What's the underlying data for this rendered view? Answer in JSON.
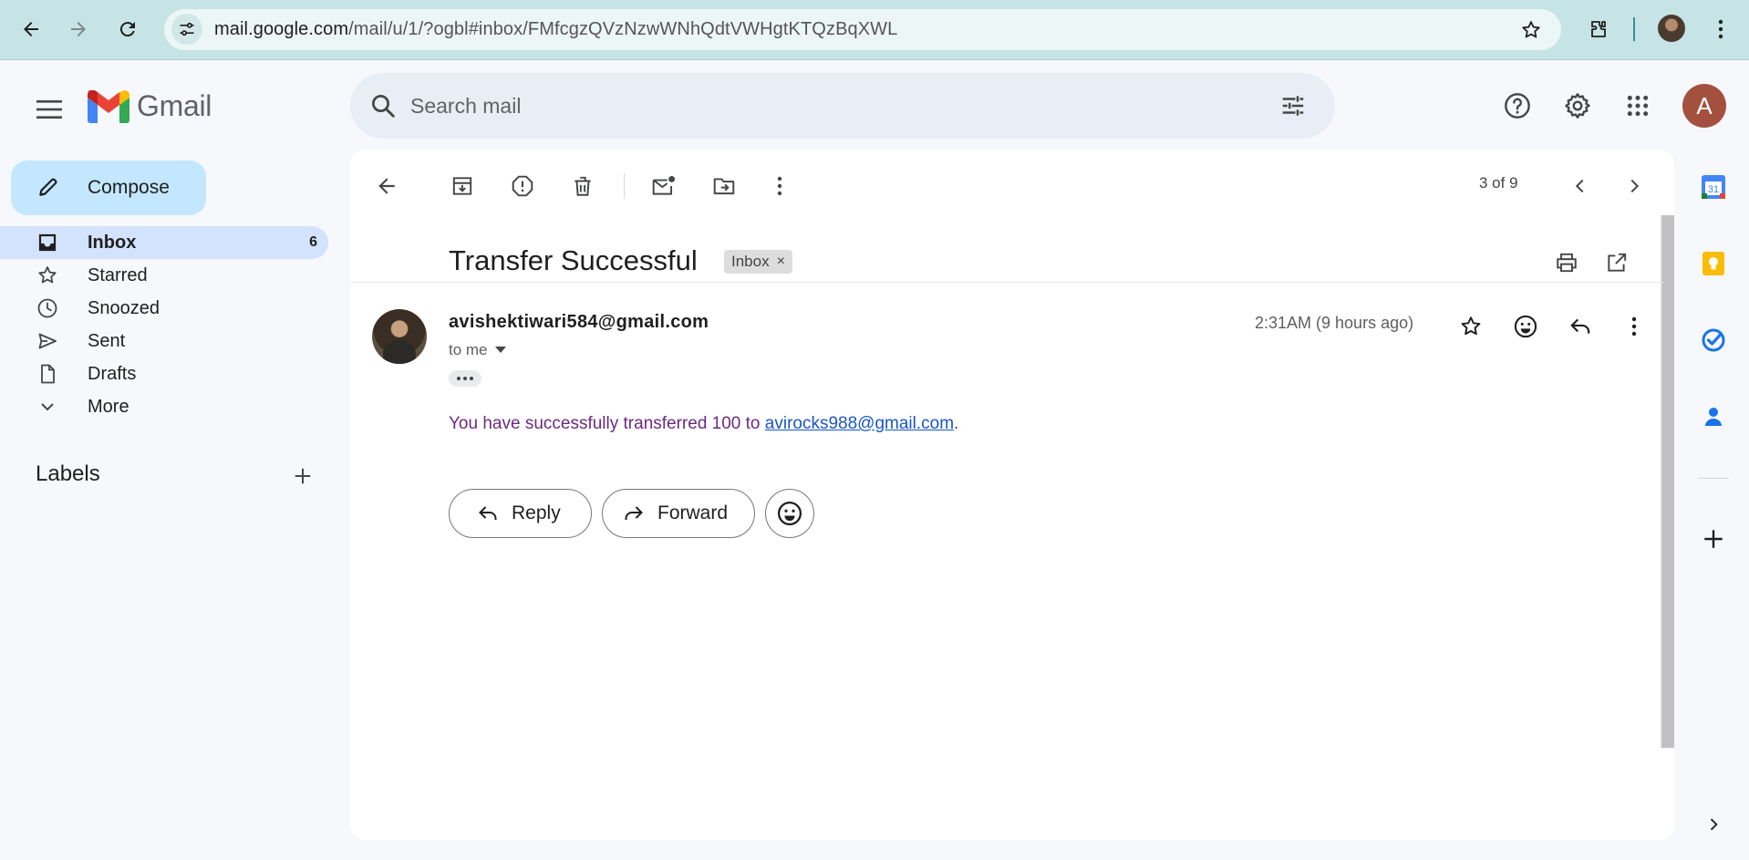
{
  "browser": {
    "url_host": "mail.google.com",
    "url_path": "/mail/u/1/?ogbl#inbox/FMfcgzQVzNzwWNhQdtVWHgtKTQzBqXWL"
  },
  "header": {
    "app_name": "Gmail",
    "search_placeholder": "Search mail",
    "account_initial": "A"
  },
  "sidebar": {
    "compose_label": "Compose",
    "items": [
      {
        "label": "Inbox",
        "count": "6",
        "icon": "inbox-icon",
        "active": true
      },
      {
        "label": "Starred",
        "count": "",
        "icon": "star-icon"
      },
      {
        "label": "Snoozed",
        "count": "",
        "icon": "clock-icon"
      },
      {
        "label": "Sent",
        "count": "",
        "icon": "send-icon"
      },
      {
        "label": "Drafts",
        "count": "",
        "icon": "draft-icon"
      },
      {
        "label": "More",
        "count": "",
        "icon": "chevron-down-icon"
      }
    ],
    "labels_heading": "Labels"
  },
  "toolbar": {
    "pager": "3 of 9"
  },
  "message": {
    "subject": "Transfer Successful",
    "label_chip": "Inbox",
    "label_chip_close": "×",
    "sender": "avishektiwari584@gmail.com",
    "recipient": "to me",
    "time": "2:31AM (9 hours ago)",
    "body_prefix": "You have successfully transferred 100 to ",
    "body_link": "avirocks988@gmail.com",
    "body_suffix": ".",
    "reply_label": "Reply",
    "forward_label": "Forward"
  },
  "side_panel": {
    "calendar_date": "31"
  },
  "colors": {
    "chrome_bg": "#c6e4e6",
    "compose_bg": "#c2e7ff",
    "active_nav_bg": "#d3e3fd",
    "body_text": "#6d2a7f",
    "link": "#1a56c4",
    "account_bg": "#a3513e"
  }
}
